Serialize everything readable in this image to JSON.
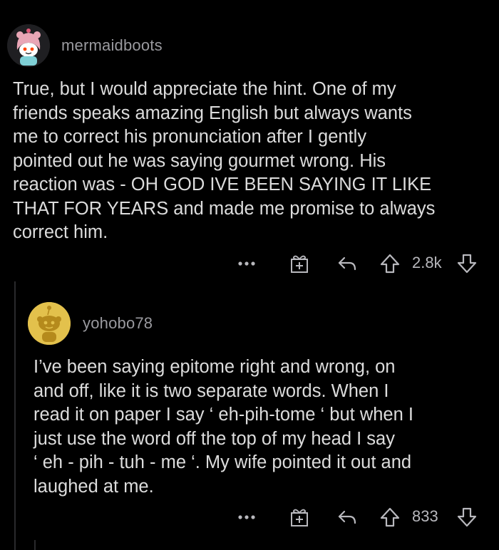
{
  "comments": [
    {
      "username": "mermaidboots",
      "avatar_icon": "snoo-pink-hood-avatar",
      "body": "True, but I would appreciate the hint. One of my\nfriends speaks amazing English but always wants\nme to correct his pronunciation after I gently\npointed out he was saying gourmet wrong. His\nreaction was - OH GOD IVE BEEN SAYING IT LIKE\nTHAT FOR YEARS and made me promise to always\ncorrect him.",
      "more_label": "•••",
      "vote_count": "2.8k"
    },
    {
      "username": "yohobo78",
      "avatar_icon": "snoo-yellow-avatar",
      "body": "I’ve been saying epitome right and wrong, on\nand off, like it is two separate words. When I\nread it on paper I say ‘ eh-pih-tome ‘ but when I\njust use the word off the top of my head I say\n‘ eh - pih - tuh - me ‘. My wife pointed it out and\nlaughed at me.",
      "more_label": "•••",
      "vote_count": "833"
    }
  ],
  "colors": {
    "background": "#000000",
    "text": "#dcdcdc",
    "muted": "#9a9a9f",
    "icon": "#b8b8bd"
  }
}
